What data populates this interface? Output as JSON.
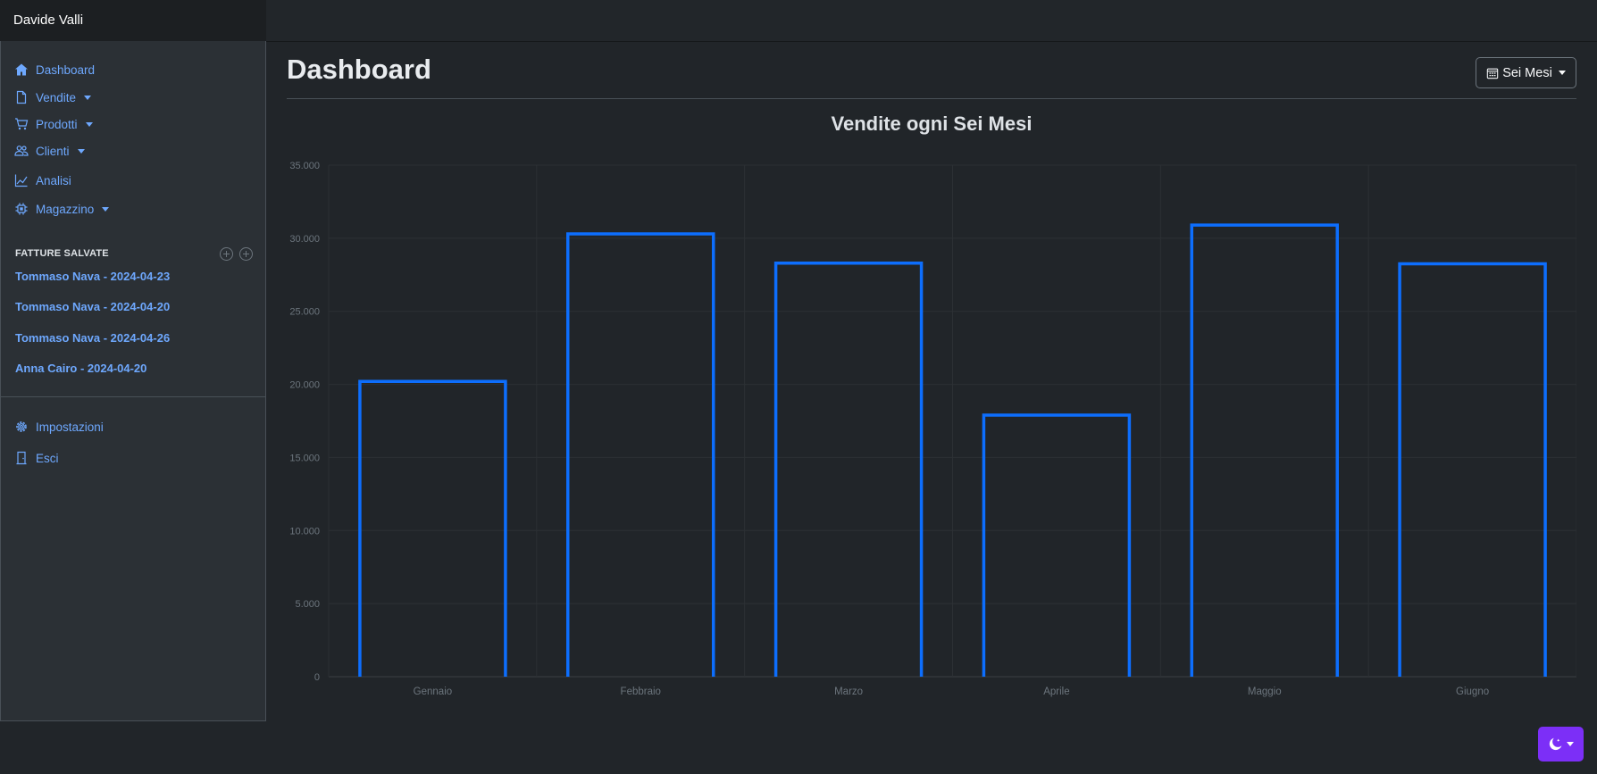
{
  "app": {
    "user_name": "Davide Valli"
  },
  "sidebar": {
    "nav": [
      {
        "label": "Dashboard",
        "icon": "house-icon"
      },
      {
        "label": "Vendite",
        "icon": "file-icon"
      },
      {
        "label": "Prodotti",
        "icon": "cart-icon"
      },
      {
        "label": "Clienti",
        "icon": "people-icon"
      },
      {
        "label": "Analisi",
        "icon": "graph-icon"
      },
      {
        "label": "Magazzino",
        "icon": "cpu-icon"
      }
    ],
    "saved_section_label": "FATTURE SALVATE",
    "saved_invoices": [
      "Tommaso Nava - 2024-04-23",
      "Tommaso Nava - 2024-04-20",
      "Tommaso Nava - 2024-04-26",
      "Anna Cairo - 2024-04-20"
    ],
    "bottom": [
      {
        "label": "Impostazioni",
        "icon": "gear-icon"
      },
      {
        "label": "Esci",
        "icon": "door-icon"
      }
    ]
  },
  "main": {
    "title": "Dashboard",
    "period_button": "Sei Mesi"
  },
  "colors": {
    "accent": "#6ea8fe",
    "bar_border": "#0d6efd",
    "theme_button": "#7c2ff7"
  },
  "chart_data": {
    "type": "bar",
    "title": "Vendite ogni Sei Mesi",
    "categories": [
      "Gennaio",
      "Febbraio",
      "Marzo",
      "Aprile",
      "Maggio",
      "Giugno"
    ],
    "values": [
      20200,
      30300,
      28300,
      17900,
      30900,
      28250
    ],
    "ylim": [
      0,
      35000
    ],
    "yticks": [
      "0",
      "5.000",
      "10.000",
      "15.000",
      "20.000",
      "25.000",
      "30.000",
      "35.000"
    ],
    "xlabel": "",
    "ylabel": "",
    "grid": true,
    "legend": "none"
  }
}
